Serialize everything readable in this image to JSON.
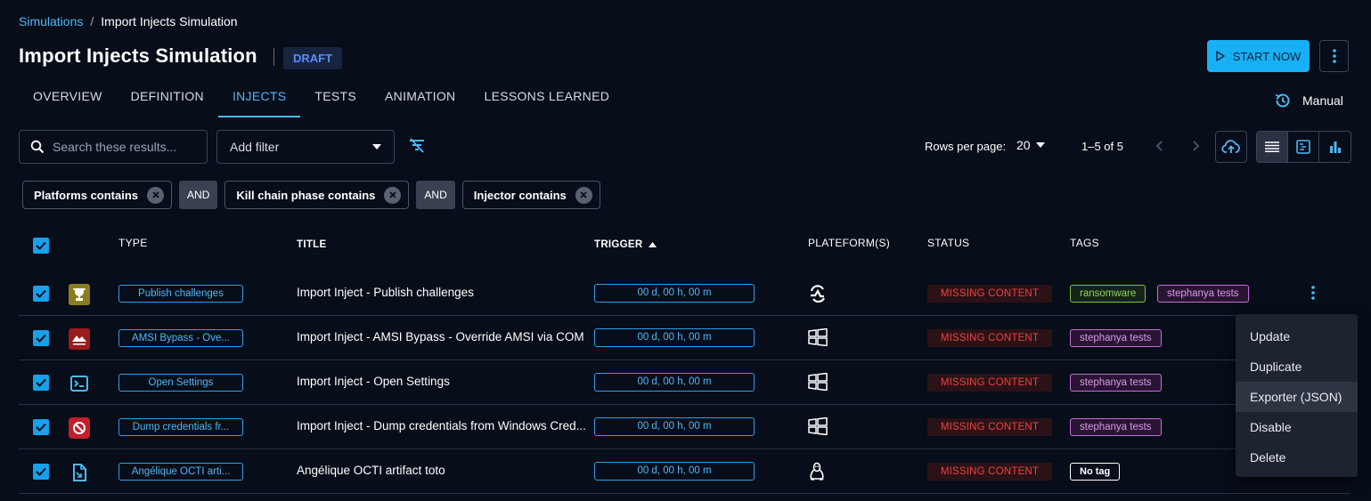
{
  "breadcrumb": {
    "parent": "Simulations",
    "separator": "/",
    "current": "Import Injects Simulation"
  },
  "header": {
    "title": "Import Injects Simulation",
    "status_badge": "DRAFT",
    "start_label": "START NOW"
  },
  "tabs": [
    {
      "label": "OVERVIEW"
    },
    {
      "label": "DEFINITION"
    },
    {
      "label": "INJECTS",
      "active": true
    },
    {
      "label": "TESTS"
    },
    {
      "label": "ANIMATION"
    },
    {
      "label": "LESSONS LEARNED"
    }
  ],
  "mode": {
    "label": "Manual"
  },
  "toolbar": {
    "search_placeholder": "Search these results...",
    "add_filter_label": "Add filter",
    "rows_per_page_label": "Rows per page:",
    "rows_per_page_value": "20",
    "pagination_text": "1–5 of 5"
  },
  "filters": {
    "chips": [
      "Platforms contains",
      "Kill chain phase contains",
      "Injector contains"
    ],
    "operator": "AND"
  },
  "table": {
    "columns": {
      "type": "TYPE",
      "title": "TITLE",
      "trigger": "TRIGGER",
      "platforms": "PLATEFORM(S)",
      "status": "STATUS",
      "tags": "TAGS"
    },
    "rows": [
      {
        "type": "Publish challenges",
        "type_icon": "trophy-icon",
        "title": "Import Inject - Publish challenges",
        "trigger": "00 d, 00 h, 00 m",
        "platform_icon": "service-platform-icon",
        "status": "MISSING CONTENT",
        "tags": [
          "ransomware",
          "stephanya tests"
        ]
      },
      {
        "type": "AMSI Bypass - Ove...",
        "type_icon": "caldera-icon",
        "title": "Import Inject - AMSI Bypass - Override AMSI via COM",
        "trigger": "00 d, 00 h, 00 m",
        "platform_icon": "windows-icon",
        "status": "MISSING CONTENT",
        "tags": [
          "stephanya tests"
        ]
      },
      {
        "type": "Open Settings",
        "type_icon": "terminal-icon",
        "title": "Import Inject - Open Settings",
        "trigger": "00 d, 00 h, 00 m",
        "platform_icon": "windows-icon",
        "status": "MISSING CONTENT",
        "tags": [
          "stephanya tests"
        ]
      },
      {
        "type": "Dump credentials fr...",
        "type_icon": "prohibited-icon",
        "title": "Import Inject - Dump credentials from Windows Cred...",
        "trigger": "00 d, 00 h, 00 m",
        "platform_icon": "windows-icon",
        "status": "MISSING CONTENT",
        "tags": [
          "stephanya tests"
        ]
      },
      {
        "type": "Angélique OCTI arti...",
        "type_icon": "file-icon",
        "title": "Angélique OCTI artifact toto",
        "trigger": "00 d, 00 h, 00 m",
        "platform_icon": "linux-icon",
        "status": "MISSING CONTENT",
        "tags": [
          "No tag"
        ]
      }
    ]
  },
  "context_menu": {
    "items": [
      "Update",
      "Duplicate",
      "Exporter (JSON)",
      "Disable",
      "Delete"
    ]
  },
  "colors": {
    "accent": "#18b0f4",
    "link": "#4fb8f5",
    "status_red": "#f0413d",
    "tag_green": "#7ac143",
    "tag_purple": "#c56edb",
    "background": "#070d19"
  }
}
